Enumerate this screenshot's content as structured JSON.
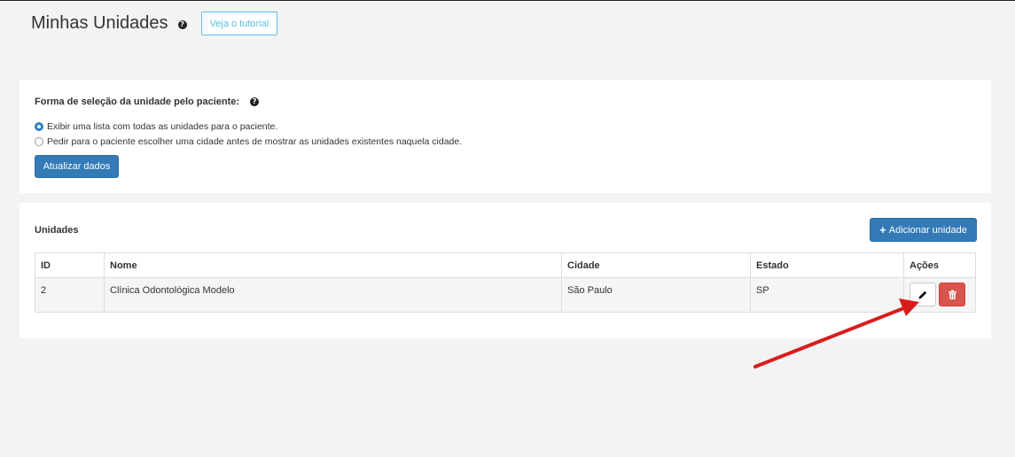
{
  "header": {
    "title": "Minhas Unidades",
    "help_icon": "?",
    "tutorial_label": "Veja o tutorial"
  },
  "selection": {
    "title": "Forma de seleção da unidade pelo paciente:",
    "help_icon": "?",
    "options": [
      {
        "label": "Exibir uma lista com todas as unidades para o paciente.",
        "checked": true
      },
      {
        "label": "Pedir para o paciente escolher uma cidade antes de mostrar as unidades existentes naquela cidade.",
        "checked": false
      }
    ],
    "update_label": "Atualizar dados"
  },
  "units": {
    "title": "Unidades",
    "add_icon": "+",
    "add_label": "Adicionar unidade",
    "columns": [
      "ID",
      "Nome",
      "Cidade",
      "Estado",
      "Ações"
    ],
    "rows": [
      {
        "id": "2",
        "name": "Clínica Odontológica Modelo",
        "city": "São Paulo",
        "state": "SP"
      }
    ]
  },
  "icons": {
    "edit": "pencil-icon",
    "delete": "trash-icon",
    "annotation": "red-arrow"
  },
  "colors": {
    "primary": "#337ab7",
    "info": "#5bc0de",
    "danger": "#d9534f",
    "arrow": "#d81c1c"
  }
}
